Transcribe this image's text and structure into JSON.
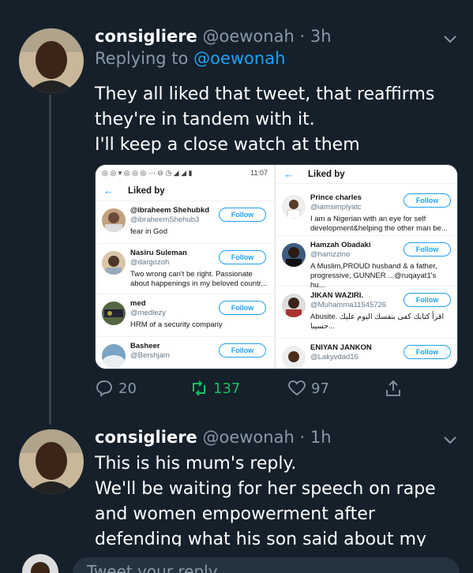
{
  "tweet1": {
    "name": "consigliere",
    "handle": "@oewonah",
    "dot": "·",
    "time": "3h",
    "replying_prefix": "Replying to",
    "replying_to": "@oewonah",
    "text_lines": [
      "They all liked that tweet, that reaffirms",
      "they're in tandem with it.",
      "I'll keep a close watch at them"
    ],
    "media": {
      "status_time": "11:07",
      "left_header": "Liked by",
      "right_header": "Liked by",
      "follow_label": "Follow",
      "left_rows": [
        {
          "name": "@ibraheem Shehubkd",
          "handle": "@ibraheemShehub3",
          "bio": "fear in God"
        },
        {
          "name": "Nasiru Suleman",
          "handle": "@dargozoh",
          "bio": "Two wrong can't be right. Passionate about happenings in my beloved countr..."
        },
        {
          "name": "med",
          "handle": "@medlezy",
          "bio": "HRM of a security company"
        },
        {
          "name": "Basheer",
          "handle": "@Bershjam",
          "bio": ""
        }
      ],
      "right_rows": [
        {
          "name": "Prince charles",
          "handle": "@iamsimplyatc",
          "bio": "I am a Nigerian with an eye for self development&helping the other man be..."
        },
        {
          "name": "Hamzah Obadaki",
          "handle": "@hamzzino",
          "bio": "A Muslim,PROUD husband & a father, progressive, GUNNER ...@ruqayat1's hu..."
        },
        {
          "name": "JIKAN WAZIRI.",
          "handle": "@Muhamma11545726",
          "bio": "Abusite. اقرأ كتابك كفى بنفسك اليوم عليك حسيبا..."
        },
        {
          "name": "ENIYAN JANKON",
          "handle": "@Lakyvdad16",
          "bio": ""
        }
      ]
    },
    "actions": {
      "replies": "20",
      "retweets": "137",
      "likes": "97"
    }
  },
  "tweet2": {
    "name": "consigliere",
    "handle": "@oewonah",
    "dot": "·",
    "time": "1h",
    "text_lines": [
      "This is his mum's reply.",
      "We'll be waiting for her speech on rape",
      "and women empowerment after",
      "defending what his son said about my"
    ]
  },
  "reply_box": {
    "placeholder": "Tweet your reply"
  },
  "colors": {
    "background": "#15202b",
    "accent": "#1da1f2",
    "retweet": "#17bf63",
    "muted": "#8899a6"
  }
}
